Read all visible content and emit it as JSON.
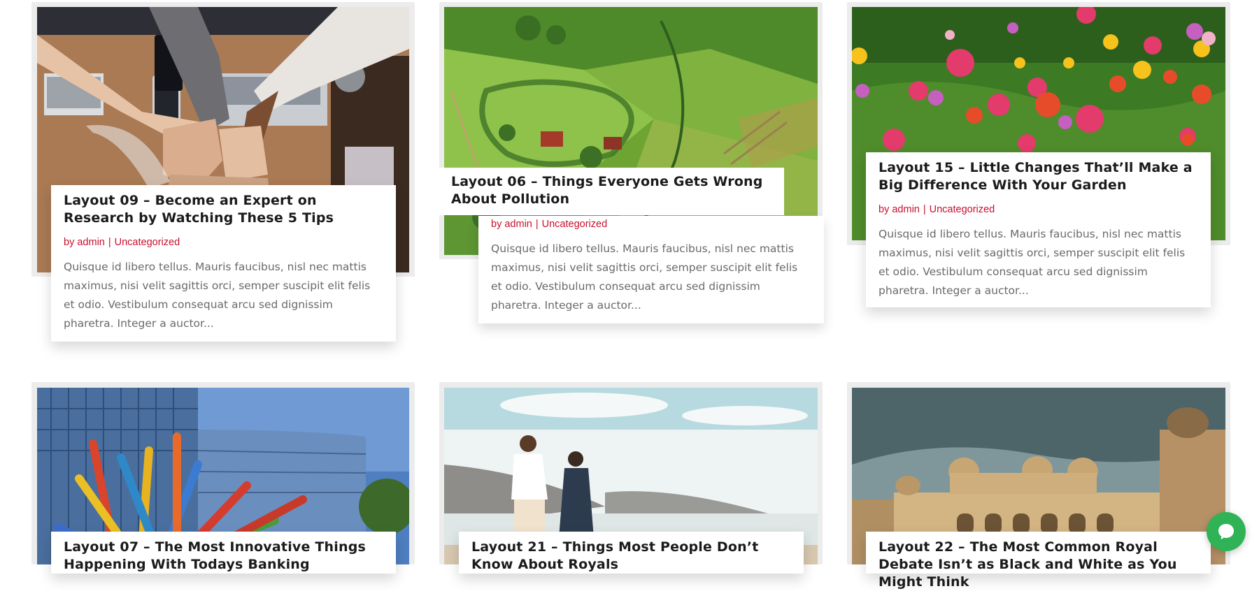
{
  "posts": [
    {
      "title": "Layout 09 – Become an Expert on Research by Watching These 5 Tips",
      "meta": {
        "by": "by",
        "author": "admin",
        "sep": "|",
        "category": "Uncategorized"
      },
      "excerpt": "Quisque id libero tellus. Mauris faucibus, nisl nec mattis maximus, nisi velit sagittis orci, semper suscipit elit felis et odio. Vestibulum consequat arcu sed dignissim pharetra. Integer a auctor..."
    },
    {
      "title": "Layout 06 – Things Everyone Gets Wrong About Pollution",
      "meta": {
        "by": "by",
        "author": "admin",
        "sep": "|",
        "category": "Uncategorized"
      },
      "excerpt": "Quisque id libero tellus. Mauris faucibus, nisl nec mattis maximus, nisi velit sagittis orci, semper suscipit elit felis et odio. Vestibulum consequat arcu sed dignissim pharetra. Integer a auctor..."
    },
    {
      "title": "Layout 15 – Little Changes That’ll Make a Big Difference With Your Garden",
      "meta": {
        "by": "by",
        "author": "admin",
        "sep": "|",
        "category": "Uncategorized"
      },
      "excerpt": "Quisque id libero tellus. Mauris faucibus, nisl nec mattis maximus, nisi velit sagittis orci, semper suscipit elit felis et odio. Vestibulum consequat arcu sed dignissim pharetra. Integer a auctor..."
    },
    {
      "title": "Layout 07 – The Most Innovative Things Happening With Todays Banking"
    },
    {
      "title": "Layout 21 – Things Most People Don’t Know About Royals"
    },
    {
      "title": "Layout 22 – The Most Common Royal Debate Isn’t as Black and White as You Might Think"
    }
  ],
  "chat_widget": {
    "icon": "chat-bubble-icon"
  }
}
